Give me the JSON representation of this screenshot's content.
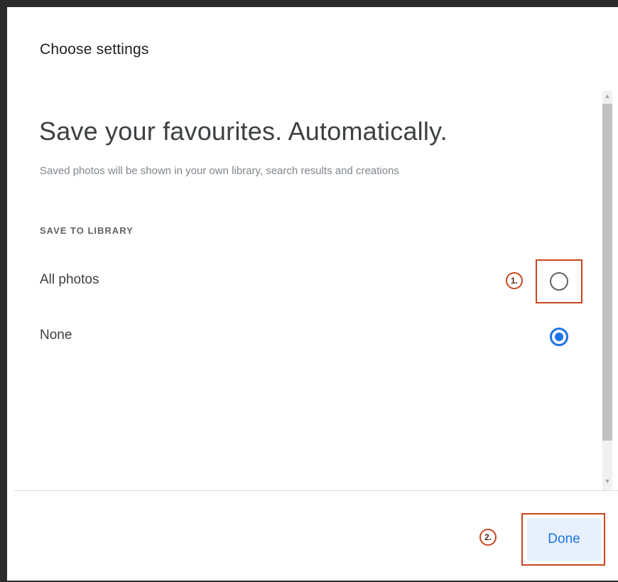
{
  "dialog": {
    "title": "Choose settings",
    "headline": "Save your favourites. Automatically.",
    "subtitle": "Saved photos will be shown in your own library, search results and creations",
    "section_label": "SAVE TO LIBRARY",
    "options": [
      {
        "label": "All photos",
        "selected": false
      },
      {
        "label": "None",
        "selected": true
      }
    ],
    "done_label": "Done"
  },
  "annotations": {
    "step1": "1.",
    "step2": "2."
  },
  "scrollbar": {
    "up_icon": "scroll-up-arrow",
    "down_icon": "scroll-down-arrow"
  },
  "colors": {
    "accent": "#1a73e8",
    "annotation": "#c9451f",
    "button_bg": "#e8f0fe"
  }
}
